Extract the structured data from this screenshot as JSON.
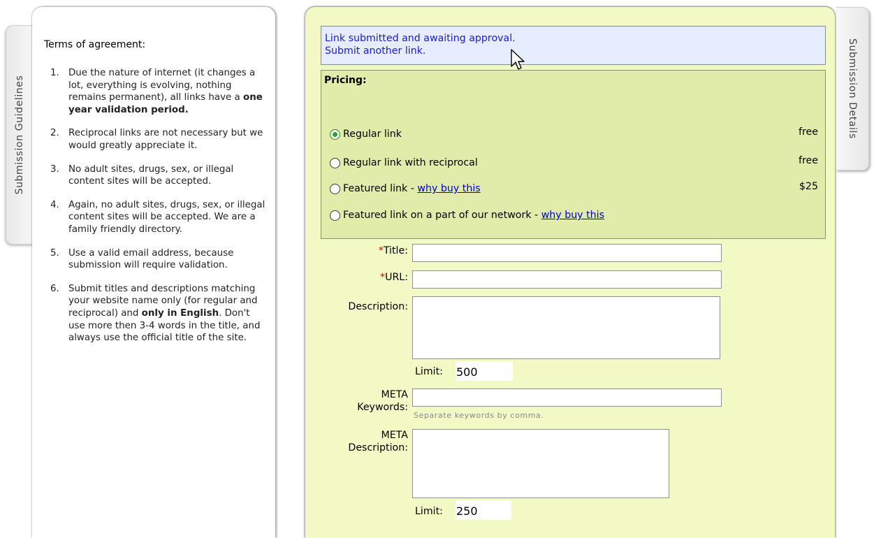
{
  "tabs": {
    "left": "Submission Guidelines",
    "right": "Submission Details"
  },
  "terms": {
    "heading": "Terms of agreement:",
    "items": [
      {
        "num": "1.",
        "text": "Due the nature of internet (it changes a lot, everything is evolving, nothing remains permanent), all links have a ",
        "bold": "one year validation period.",
        "after": ""
      },
      {
        "num": "2.",
        "text": "Reciprocal links are not necessary but we would greatly appreciate it.",
        "bold": "",
        "after": ""
      },
      {
        "num": "3.",
        "text": "No adult sites, drugs, sex, or illegal content sites will be accepted.",
        "bold": "",
        "after": ""
      },
      {
        "num": "4.",
        "text": "Again, no adult sites, drugs, sex, or illegal content sites will be accepted. We are a family friendly directory.",
        "bold": "",
        "after": ""
      },
      {
        "num": "5.",
        "text": "Use a valid email address, because submission will require validation.",
        "bold": "",
        "after": ""
      },
      {
        "num": "6.",
        "text": "Submit titles and descriptions matching your website name only (for regular and reciprocal) and ",
        "bold": "only in English",
        "after": ". Don't use more then 3-4 words in the title, and always use the official title of the site."
      }
    ]
  },
  "notice": {
    "line1": "Link submitted and awaiting approval.",
    "line2": "Submit another link."
  },
  "pricing": {
    "title": "Pricing:",
    "options": [
      {
        "label": "Regular link",
        "link": "",
        "price": "free",
        "checked": true
      },
      {
        "label": "Regular link with reciprocal",
        "link": "",
        "price": "free",
        "checked": false
      },
      {
        "label": "Featured link - ",
        "link": "why buy this",
        "price": "$25",
        "checked": false
      },
      {
        "label": "Featured link on a part of our network - ",
        "link": "why buy this",
        "price": "",
        "checked": false
      }
    ]
  },
  "form": {
    "required_mark": "*",
    "title_label": "Title:",
    "url_label": "URL:",
    "description_label": "Description:",
    "limit_label": "Limit:",
    "description_limit": "500",
    "meta_keywords_label_1": "META",
    "meta_keywords_label_2": "Keywords:",
    "meta_keywords_hint": "Separate keywords by comma.",
    "meta_description_label_1": "META",
    "meta_description_label_2": "Description:",
    "meta_description_limit": "250"
  }
}
